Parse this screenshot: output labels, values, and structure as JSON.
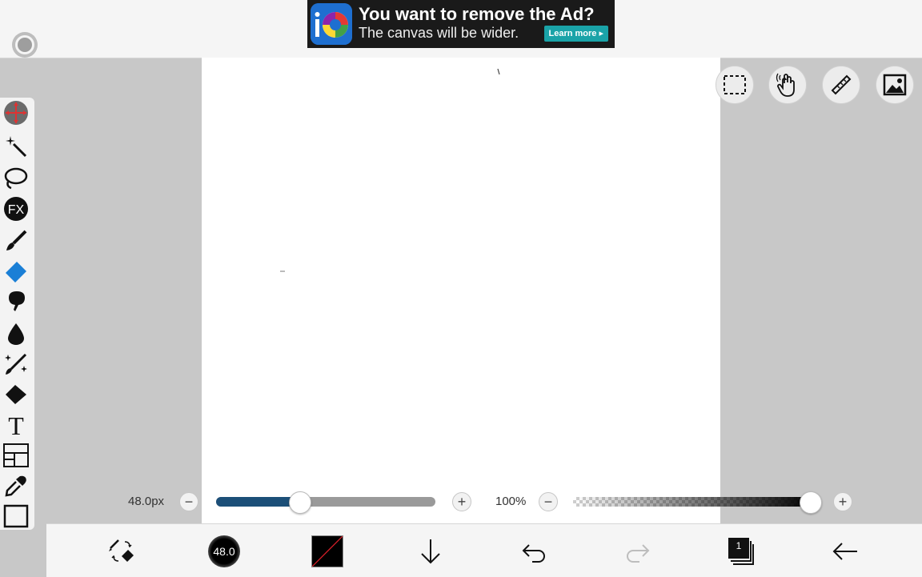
{
  "ad": {
    "title": "You want to remove the Ad?",
    "subtitle": "The canvas will be wider.",
    "cta": "Learn more"
  },
  "brush": {
    "size_label": "48.0px",
    "size_fraction": 0.38,
    "size_button_label": "48.0"
  },
  "opacity": {
    "label": "100%",
    "value_fraction": 1.0
  },
  "tools": [
    {
      "name": "transform-tool",
      "icon": "move-crosshair-icon"
    },
    {
      "name": "magic-wand-tool",
      "icon": "magic-wand-icon"
    },
    {
      "name": "lasso-tool",
      "icon": "lasso-icon"
    },
    {
      "name": "filter-tool",
      "icon": "fx-icon",
      "label": "FX"
    },
    {
      "name": "brush-tool",
      "icon": "brush-icon"
    },
    {
      "name": "eraser-tool",
      "icon": "eraser-icon"
    },
    {
      "name": "smudge-tool",
      "icon": "smudge-icon"
    },
    {
      "name": "blur-tool",
      "icon": "droplet-icon"
    },
    {
      "name": "special-brush-tool",
      "icon": "sparkle-brush-icon"
    },
    {
      "name": "fill-tool",
      "icon": "bucket-icon"
    },
    {
      "name": "text-tool",
      "icon": "text-icon",
      "label": "T"
    },
    {
      "name": "frame-divider-tool",
      "icon": "panel-icon"
    },
    {
      "name": "eyedropper-tool",
      "icon": "eyedropper-icon"
    },
    {
      "name": "canvas-tool",
      "icon": "canvas-frame-icon"
    }
  ],
  "quick_tools": [
    "selection-icon",
    "hand-icon",
    "ruler-icon",
    "image-icon"
  ],
  "bottom": {
    "layer_count": "1"
  },
  "colors": {
    "accent": "#1c4f78",
    "eraser_blue": "#1a7fd6",
    "ad_button": "#1aa3a8"
  }
}
